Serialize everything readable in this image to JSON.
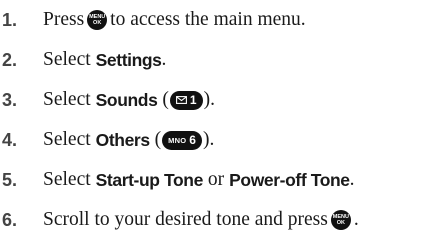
{
  "colors": {
    "text": "#1a1a1a",
    "number": "#444444",
    "key_bg": "#111111",
    "key_fg": "#ffffff"
  },
  "steps": [
    {
      "number": "1.",
      "before": "Press",
      "key": {
        "top": "MENU",
        "bottom": "OK"
      },
      "after": "to access the main menu."
    },
    {
      "number": "2.",
      "before": "Select",
      "bold": "Settings",
      "after": "."
    },
    {
      "number": "3.",
      "before": "Select",
      "bold": "Sounds",
      "open": "(",
      "key": {
        "icon": "envelope-icon",
        "digit": "1"
      },
      "close": ")."
    },
    {
      "number": "4.",
      "before": "Select",
      "bold": "Others",
      "open": "(",
      "key": {
        "label": "MNO",
        "digit": "6"
      },
      "close": ")."
    },
    {
      "number": "5.",
      "before": "Select",
      "bold": "Start-up Tone",
      "middle": "or",
      "bold2": "Power-off Tone",
      "after": "."
    },
    {
      "number": "6.",
      "before": "Scroll to your desired tone and press",
      "key": {
        "top": "MENU",
        "bottom": "OK"
      },
      "after": "."
    }
  ]
}
